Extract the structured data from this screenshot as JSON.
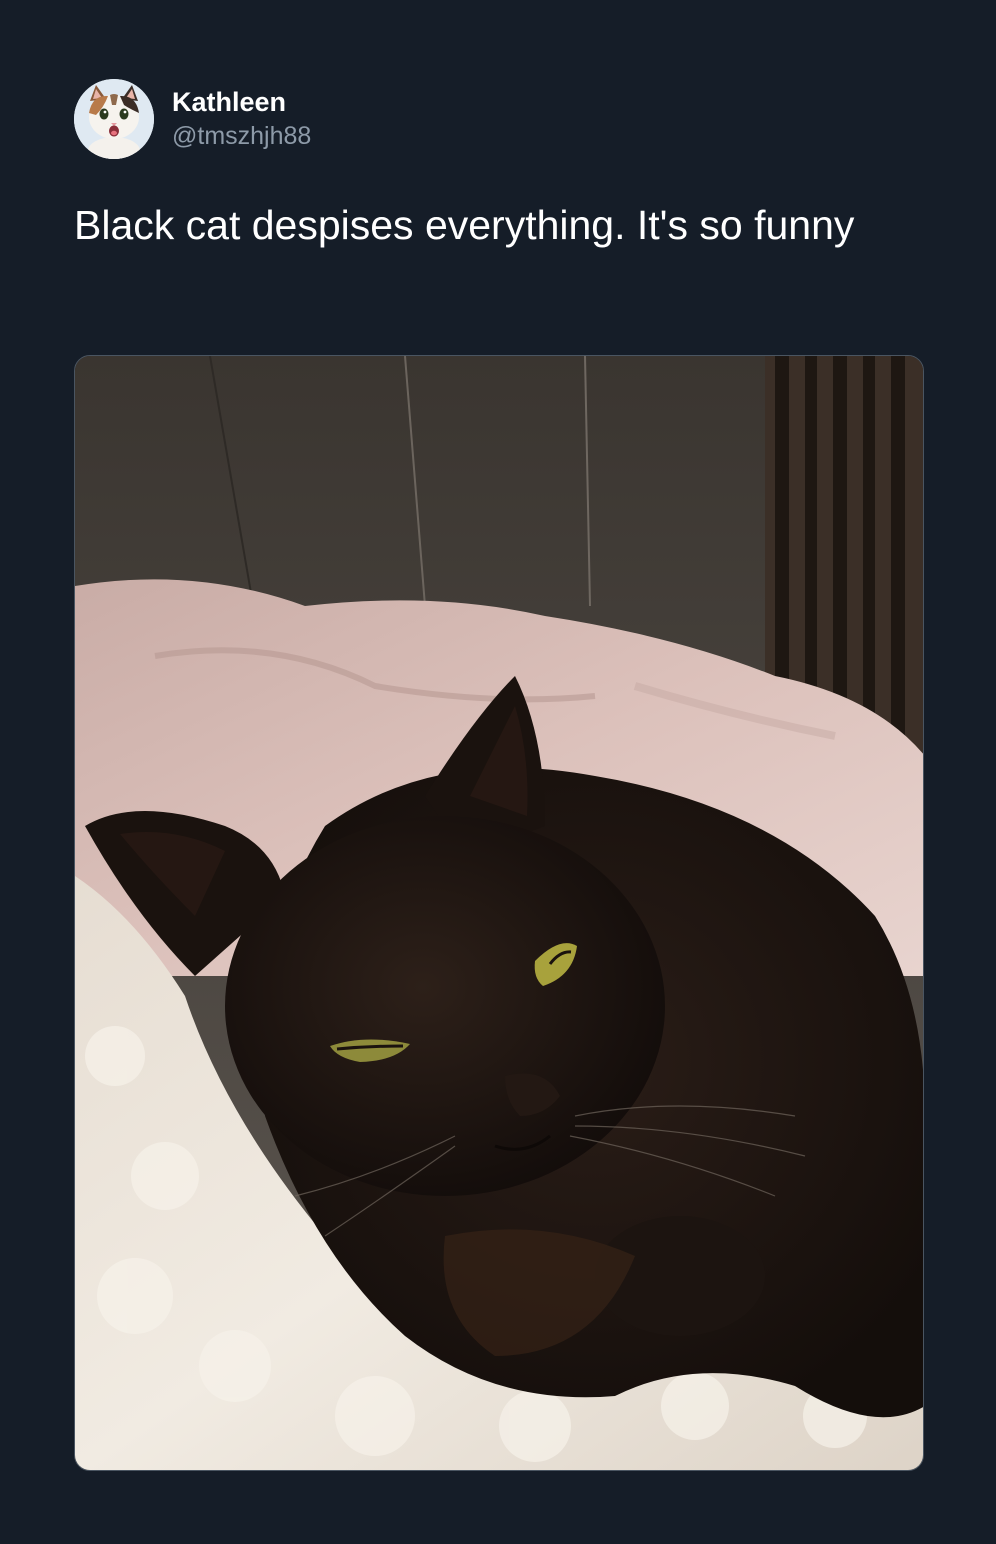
{
  "tweet": {
    "author": {
      "display_name": "Kathleen",
      "handle": "@tmszhjh88",
      "avatar_icon": "calico-cat-avatar"
    },
    "text": "Black cat despises everything. It's so funny",
    "media": {
      "kind": "photo",
      "subject_icon": "black-cat-photo"
    }
  },
  "colors": {
    "background": "#151d28",
    "text_primary": "#ffffff",
    "text_secondary": "#8d9aa8",
    "media_border": "#4a5561"
  }
}
